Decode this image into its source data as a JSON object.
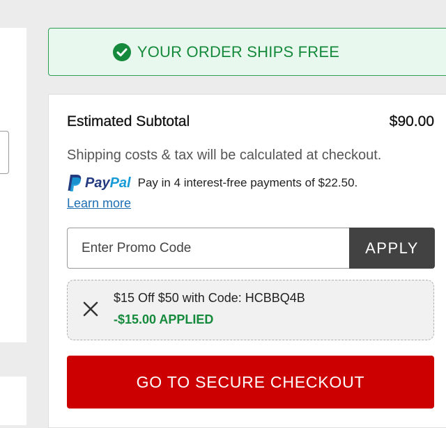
{
  "shipping_banner": {
    "text": "YOUR ORDER SHIPS FREE"
  },
  "summary": {
    "subtotal_label": "Estimated Subtotal",
    "subtotal_value": "$90.00",
    "shipping_note": "Shipping costs & tax will be calculated at checkout."
  },
  "paypal": {
    "logo_pay": "Pay",
    "logo_pal": "Pal",
    "message": "Pay in 4 interest-free payments of $22.50.",
    "learn_more": "Learn more"
  },
  "promo": {
    "placeholder": "Enter Promo Code",
    "apply_label": "APPLY"
  },
  "applied_coupon": {
    "description": "$15 Off $50 with Code: HCBBQ4B",
    "status": "-$15.00 APPLIED"
  },
  "checkout": {
    "label": "GO TO SECURE CHECKOUT"
  },
  "colors": {
    "accent_red": "#cc0000",
    "success_green": "#168a3c",
    "apply_button": "#424242"
  }
}
